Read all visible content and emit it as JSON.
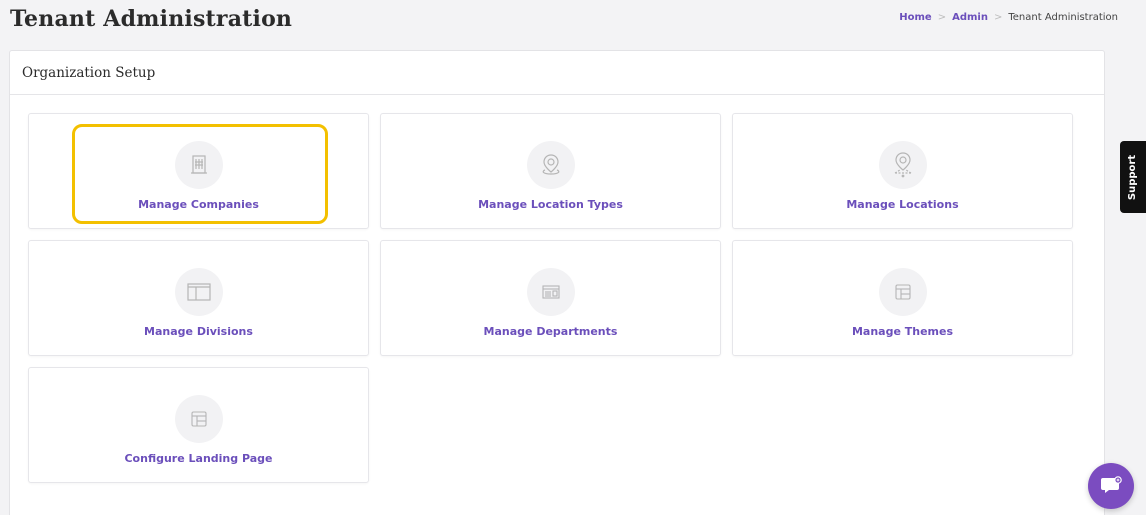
{
  "header": {
    "title": "Tenant Administration",
    "breadcrumb": {
      "home": "Home",
      "admin": "Admin",
      "current": "Tenant Administration",
      "separator": ">"
    }
  },
  "panel": {
    "title": "Organization Setup",
    "tiles": [
      {
        "label": "Manage Companies",
        "icon": "building-icon",
        "highlighted": true
      },
      {
        "label": "Manage Location Types",
        "icon": "map-pin-icon"
      },
      {
        "label": "Manage Locations",
        "icon": "location-pin-icon"
      },
      {
        "label": "Manage Divisions",
        "icon": "divisions-icon"
      },
      {
        "label": "Manage Departments",
        "icon": "departments-icon"
      },
      {
        "label": "Manage Themes",
        "icon": "themes-icon"
      },
      {
        "label": "Configure Landing Page",
        "icon": "landing-page-icon"
      }
    ]
  },
  "support": {
    "label": "Support"
  },
  "colors": {
    "accent": "#6b4fbb",
    "highlight": "#f3c000",
    "chat_button": "#7b4cc0"
  }
}
